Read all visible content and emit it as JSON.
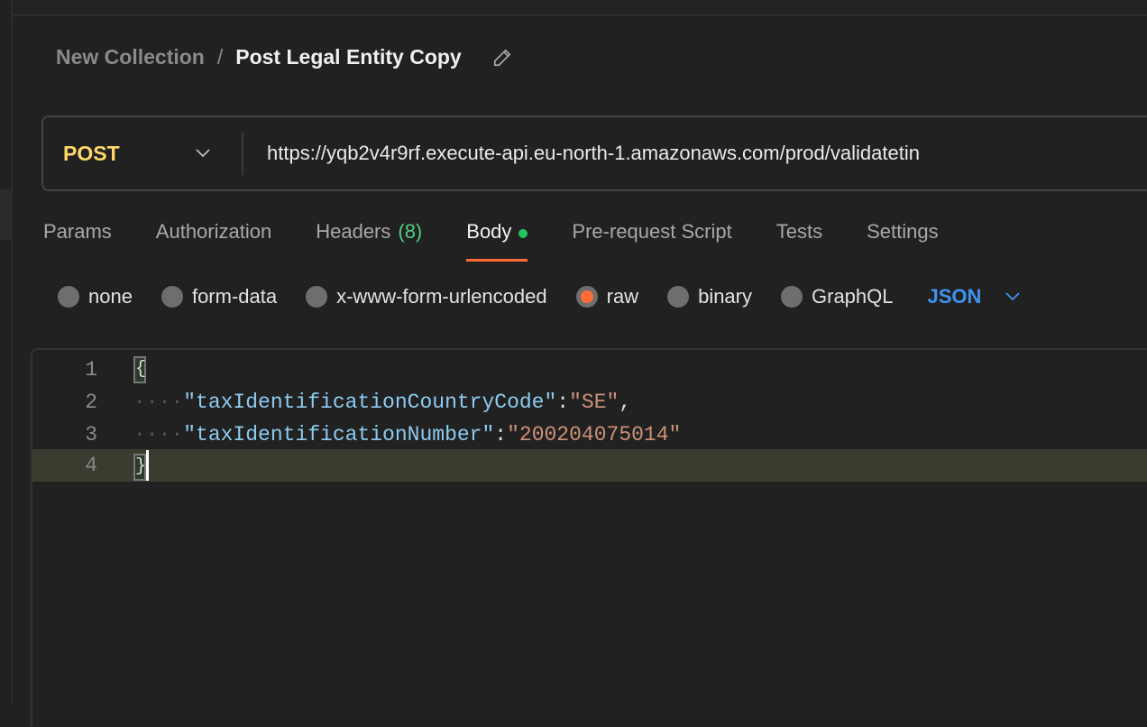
{
  "breadcrumb": {
    "collection": "New Collection",
    "separator": "/",
    "request": "Post Legal Entity Copy"
  },
  "request": {
    "method": "POST",
    "url": "https://yqb2v4r9rf.execute-api.eu-north-1.amazonaws.com/prod/validatetin"
  },
  "tabs": [
    {
      "label": "Params"
    },
    {
      "label": "Authorization"
    },
    {
      "label": "Headers",
      "count": "(8)"
    },
    {
      "label": "Body",
      "active": true
    },
    {
      "label": "Pre-request Script"
    },
    {
      "label": "Tests"
    },
    {
      "label": "Settings"
    }
  ],
  "body_types": [
    {
      "label": "none"
    },
    {
      "label": "form-data"
    },
    {
      "label": "x-www-form-urlencoded"
    },
    {
      "label": "raw",
      "selected": true
    },
    {
      "label": "binary"
    },
    {
      "label": "GraphQL"
    }
  ],
  "format": "JSON",
  "editor": {
    "line_numbers": [
      "1",
      "2",
      "3",
      "4"
    ],
    "open_brace": "{",
    "close_brace": "}",
    "key1": "\"taxIdentificationCountryCode\"",
    "val1": "\"SE\"",
    "key2": "\"taxIdentificationNumber\"",
    "val2": "\"200204075014\"",
    "colon": ":",
    "comma": ",",
    "indent": "····"
  },
  "colors": {
    "accent": "#ff6c37",
    "method": "#ffd866",
    "count": "#4fcf80",
    "format": "#3f93f0",
    "json_key": "#8dcbf0",
    "json_string": "#ce9178"
  }
}
